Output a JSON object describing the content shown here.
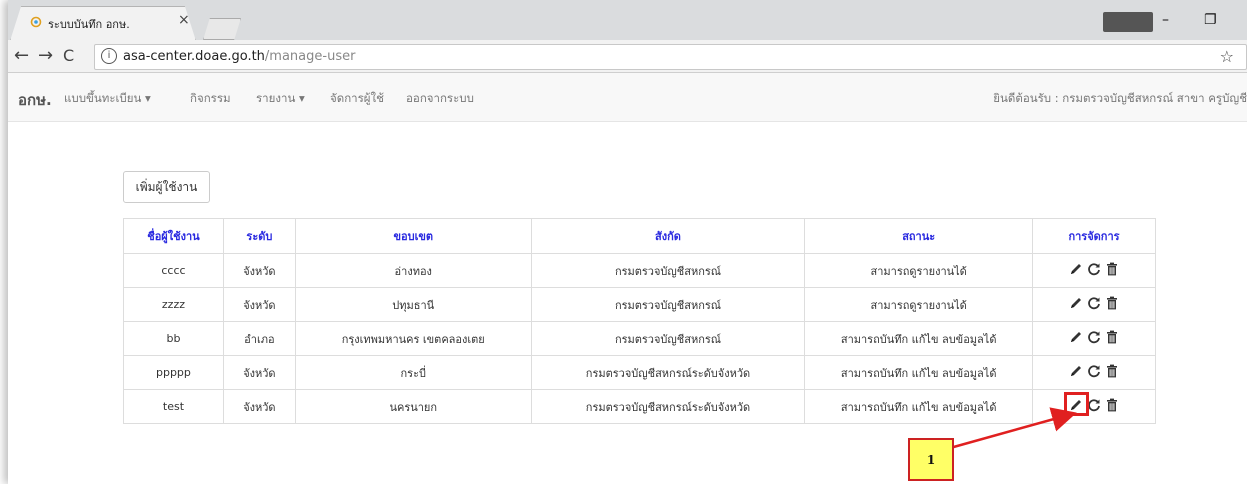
{
  "browser": {
    "tab_title": "ระบบบันทึก อกษ.",
    "tab_close": "×",
    "url_host": "asa-center.doae.go.th",
    "url_path": "/manage-user",
    "window_controls": [
      "–",
      "❐"
    ]
  },
  "navbar": {
    "brand": "อกษ.",
    "items": [
      {
        "label": "แบบขึ้นทะเบียน ▾"
      },
      {
        "label": "กิจกรรม"
      },
      {
        "label": "รายงาน ▾"
      },
      {
        "label": "จัดการผู้ใช้"
      },
      {
        "label": "ออกจากระบบ"
      }
    ],
    "welcome": "ยินดีต้อนรับ : กรมตรวจบัญชีสหกรณ์ สาขา ครูบัญชี"
  },
  "page": {
    "add_user_label": "เพิ่มผู้ใช้งาน"
  },
  "table": {
    "headers": [
      "ชื่อผู้ใช้งาน",
      "ระดับ",
      "ขอบเขต",
      "สังกัด",
      "สถานะ",
      "การจัดการ"
    ],
    "rows": [
      [
        "cccc",
        "จังหวัด",
        "อ่างทอง",
        "กรมตรวจบัญชีสหกรณ์",
        "สามารถดูรายงานได้"
      ],
      [
        "zzzz",
        "จังหวัด",
        "ปทุมธานี",
        "กรมตรวจบัญชีสหกรณ์",
        "สามารถดูรายงานได้"
      ],
      [
        "bb",
        "อำเภอ",
        "กรุงเทพมหานคร เขตคลองเตย",
        "กรมตรวจบัญชีสหกรณ์",
        "สามารถบันทึก แก้ไข ลบข้อมูลได้"
      ],
      [
        "ppppp",
        "จังหวัด",
        "กระบี่",
        "กรมตรวจบัญชีสหกรณ์ระดับจังหวัด",
        "สามารถบันทึก แก้ไข ลบข้อมูลได้"
      ],
      [
        "test",
        "จังหวัด",
        "นครนายก",
        "กรมตรวจบัญชีสหกรณ์ระดับจังหวัด",
        "สามารถบันทึก แก้ไข ลบข้อมูลได้"
      ]
    ],
    "action_icons": [
      "pencil-icon",
      "refresh-icon",
      "trash-icon"
    ]
  },
  "annotation": {
    "callout_label": "1",
    "highlight_color": "#e02020",
    "callout_bg": "#ffff66"
  }
}
